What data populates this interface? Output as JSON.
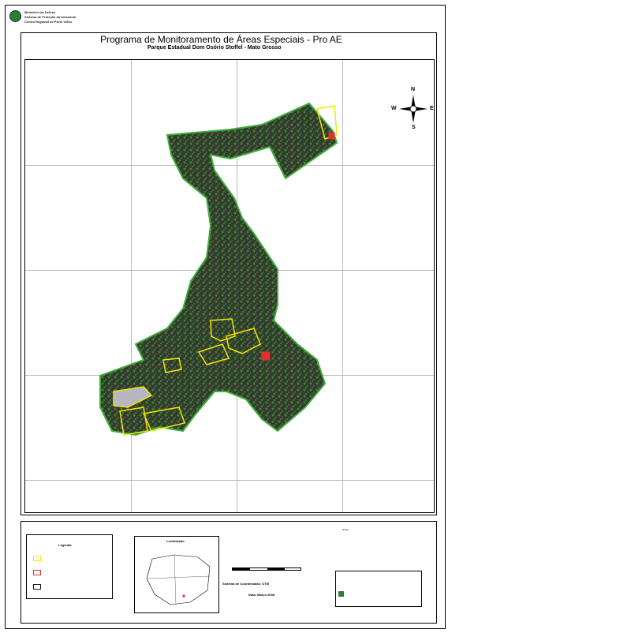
{
  "header": {
    "logo_lines": [
      "Ministério da Defesa",
      "Sistema de Proteção da Amazônia",
      "Centro Regional de Porto Velho"
    ],
    "title": "Programa de Monitoramento de Áreas Especiais - Pro AE",
    "subtitle": "Parque Estadual Dom Osório Stoffel - Mato Grosso"
  },
  "compass": {
    "n": "N",
    "s": "S",
    "e": "E",
    "w": "W"
  },
  "legend": {
    "title": "Legenda",
    "items": [
      {
        "label": "",
        "color": "#f5e600"
      },
      {
        "label": "",
        "color": "#e03030"
      },
      {
        "label": "",
        "color": "#1a1a1a"
      }
    ]
  },
  "location": {
    "title": "Localização"
  },
  "scale": {
    "projection": "Sistema de Coordenadas: UTM",
    "scale_text": "",
    "ticks": [
      "",
      "",
      "",
      "",
      ""
    ]
  },
  "footer": {
    "date": "Data: Março 2008"
  },
  "notes": {
    "title": "Notas"
  },
  "colors": {
    "polygon_yellow": "#f5e600",
    "polygon_red": "#e03030",
    "vegetation_dark": "#2e3d2a",
    "vegetation_green": "#3fae3a"
  }
}
